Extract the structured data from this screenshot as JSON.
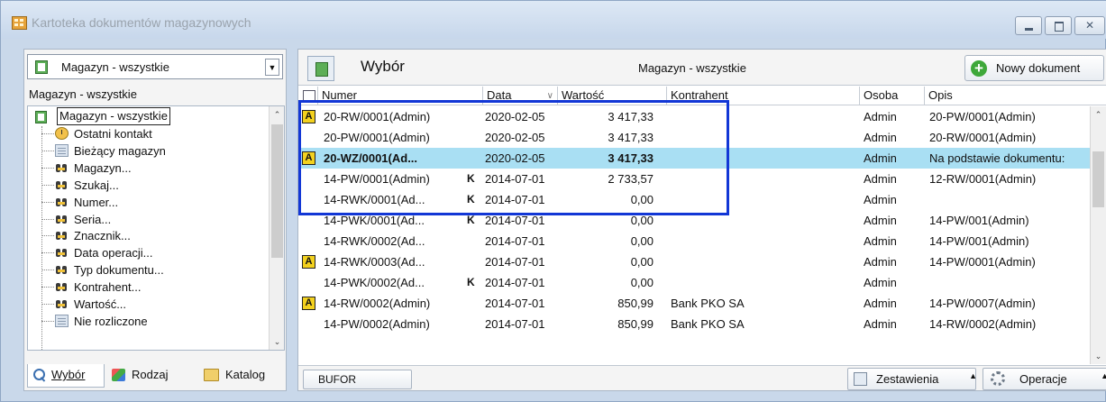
{
  "window": {
    "title": "Kartoteka dokumentów magazynowych"
  },
  "left": {
    "combo_value": "Magazyn - wszystkie",
    "label": "Magazyn - wszystkie",
    "tree_root": "Magazyn - wszystkie",
    "tree_items": [
      {
        "label": "Ostatni kontakt",
        "icon": "clock-icon"
      },
      {
        "label": "Bieżący magazyn",
        "icon": "grid-icon"
      },
      {
        "label": "Magazyn...",
        "icon": "binoculars-icon"
      },
      {
        "label": "Szukaj...",
        "icon": "binoculars-icon"
      },
      {
        "label": "Numer...",
        "icon": "binoculars-icon"
      },
      {
        "label": "Seria...",
        "icon": "binoculars-icon"
      },
      {
        "label": "Znacznik...",
        "icon": "binoculars-icon"
      },
      {
        "label": "Data operacji...",
        "icon": "binoculars-icon"
      },
      {
        "label": "Typ dokumentu...",
        "icon": "binoculars-icon"
      },
      {
        "label": "Kontrahent...",
        "icon": "binoculars-icon"
      },
      {
        "label": "Wartość...",
        "icon": "binoculars-icon"
      },
      {
        "label": "Nie rozliczone",
        "icon": "grid-icon"
      }
    ],
    "tabs": [
      "Wybór",
      "Rodzaj",
      "Katalog"
    ]
  },
  "right": {
    "header_title": "Wybór",
    "header_center": "Magazyn - wszystkie",
    "new_doc_label": "Nowy dokument",
    "columns": [
      "Numer",
      "Data",
      "Wartość",
      "Kontrahent",
      "Osoba",
      "Opis"
    ],
    "rows": [
      {
        "badge": "A",
        "numer": "20-RW/0001(Admin)",
        "k": "",
        "data": "2020-02-05",
        "wartosc": "3 417,33",
        "kontrahent": "",
        "osoba": "Admin",
        "opis": "20-PW/0001(Admin)",
        "selected": false
      },
      {
        "badge": "",
        "numer": "20-PW/0001(Admin)",
        "k": "",
        "data": "2020-02-05",
        "wartosc": "3 417,33",
        "kontrahent": "",
        "osoba": "Admin",
        "opis": "20-RW/0001(Admin)",
        "selected": false
      },
      {
        "badge": "A",
        "numer": "20-WZ/0001(Ad...",
        "k": "",
        "data": "2020-02-05",
        "wartosc": "3 417,33",
        "kontrahent": "",
        "osoba": "Admin",
        "opis": "Na podstawie dokumentu:",
        "selected": true
      },
      {
        "badge": "",
        "numer": "14-PW/0001(Admin)",
        "k": "K",
        "data": "2014-07-01",
        "wartosc": "2 733,57",
        "kontrahent": "",
        "osoba": "Admin",
        "opis": "12-RW/0001(Admin)",
        "selected": false
      },
      {
        "badge": "",
        "numer": "14-RWK/0001(Ad...",
        "k": "K",
        "data": "2014-07-01",
        "wartosc": "0,00",
        "kontrahent": "",
        "osoba": "Admin",
        "opis": "",
        "selected": false
      },
      {
        "badge": "",
        "numer": "14-PWK/0001(Ad...",
        "k": "K",
        "data": "2014-07-01",
        "wartosc": "0,00",
        "kontrahent": "",
        "osoba": "Admin",
        "opis": "14-PW/001(Admin)",
        "selected": false
      },
      {
        "badge": "",
        "numer": "14-RWK/0002(Ad...",
        "k": "",
        "data": "2014-07-01",
        "wartosc": "0,00",
        "kontrahent": "",
        "osoba": "Admin",
        "opis": "14-PW/001(Admin)",
        "selected": false
      },
      {
        "badge": "A",
        "numer": "14-RWK/0003(Ad...",
        "k": "",
        "data": "2014-07-01",
        "wartosc": "0,00",
        "kontrahent": "",
        "osoba": "Admin",
        "opis": "14-PW/0001(Admin)",
        "selected": false
      },
      {
        "badge": "",
        "numer": "14-PWK/0002(Ad...",
        "k": "K",
        "data": "2014-07-01",
        "wartosc": "0,00",
        "kontrahent": "",
        "osoba": "Admin",
        "opis": "",
        "selected": false
      },
      {
        "badge": "A",
        "numer": "14-RW/0002(Admin)",
        "k": "",
        "data": "2014-07-01",
        "wartosc": "850,99",
        "kontrahent": "Bank PKO SA",
        "osoba": "Admin",
        "opis": "14-PW/0007(Admin)",
        "selected": false
      },
      {
        "badge": "",
        "numer": "14-PW/0002(Admin)",
        "k": "",
        "data": "2014-07-01",
        "wartosc": "850,99",
        "kontrahent": "Bank PKO SA",
        "osoba": "Admin",
        "opis": "14-RW/0002(Admin)",
        "selected": false
      }
    ],
    "footer": {
      "bufor": "BUFOR",
      "zestawienia": "Zestawienia",
      "operacje": "Operacje"
    }
  }
}
